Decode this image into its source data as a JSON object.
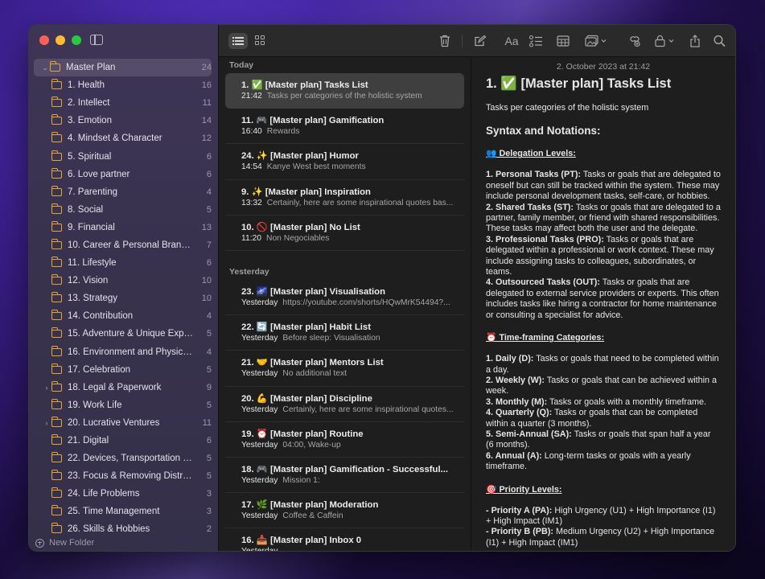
{
  "sidebar": {
    "new_folder_label": "New Folder",
    "folders": [
      {
        "name": "Master Plan",
        "count": "24",
        "chevron": "⌄",
        "selected": true,
        "indent": 0
      },
      {
        "name": "1. Health",
        "count": "16",
        "chevron": "",
        "indent": 1
      },
      {
        "name": "2. Intellect",
        "count": "11",
        "chevron": "",
        "indent": 1
      },
      {
        "name": "3. Emotion",
        "count": "14",
        "chevron": "",
        "indent": 1
      },
      {
        "name": "4. Mindset & Character",
        "count": "12",
        "chevron": "",
        "indent": 1
      },
      {
        "name": "5. Spiritual",
        "count": "6",
        "chevron": "",
        "indent": 1
      },
      {
        "name": "6. Love partner",
        "count": "6",
        "chevron": "",
        "indent": 1
      },
      {
        "name": "7. Parenting",
        "count": "4",
        "chevron": "",
        "indent": 1
      },
      {
        "name": "8. Social",
        "count": "5",
        "chevron": "",
        "indent": 1
      },
      {
        "name": "9. Financial",
        "count": "13",
        "chevron": "",
        "indent": 1
      },
      {
        "name": "10. Career & Personal Branding",
        "count": "7",
        "chevron": "",
        "indent": 1
      },
      {
        "name": "11. Lifestyle",
        "count": "6",
        "chevron": "",
        "indent": 1
      },
      {
        "name": "12. Vision",
        "count": "10",
        "chevron": "",
        "indent": 1
      },
      {
        "name": "13. Strategy",
        "count": "10",
        "chevron": "",
        "indent": 1
      },
      {
        "name": "14. Contribution",
        "count": "4",
        "chevron": "",
        "indent": 1
      },
      {
        "name": "15. Adventure & Unique Exper...",
        "count": "5",
        "chevron": "",
        "indent": 1
      },
      {
        "name": "16. Environment and Physical...",
        "count": "4",
        "chevron": "",
        "indent": 1
      },
      {
        "name": "17. Celebration",
        "count": "5",
        "chevron": "",
        "indent": 1
      },
      {
        "name": "18. Legal & Paperwork",
        "count": "9",
        "chevron": "›",
        "indent": 1
      },
      {
        "name": "19. Work Life",
        "count": "5",
        "chevron": "",
        "indent": 1
      },
      {
        "name": "20. Lucrative Ventures",
        "count": "11",
        "chevron": "›",
        "indent": 1
      },
      {
        "name": "21. Digital",
        "count": "6",
        "chevron": "",
        "indent": 1
      },
      {
        "name": "22. Devices, Transportation &...",
        "count": "5",
        "chevron": "",
        "indent": 1
      },
      {
        "name": "23. Focus & Removing Distrac...",
        "count": "5",
        "chevron": "",
        "indent": 1
      },
      {
        "name": "24. Life Problems",
        "count": "3",
        "chevron": "",
        "indent": 1
      },
      {
        "name": "25. Time Management",
        "count": "3",
        "chevron": "",
        "indent": 1
      },
      {
        "name": "26. Skills & Hobbies",
        "count": "2",
        "chevron": "",
        "indent": 1
      }
    ]
  },
  "notes": {
    "sections": [
      {
        "header": "Today",
        "items": [
          {
            "title": "1. ✅ [Master plan] Tasks List",
            "time": "21:42",
            "preview": "Tasks per categories of the holistic system",
            "selected": true
          },
          {
            "title": "11. 🎮 [Master plan] Gamification",
            "time": "16:40",
            "preview": "Rewards"
          },
          {
            "title": "24. ✨ [Master plan] Humor",
            "time": "14:54",
            "preview": "Kanye West best moments"
          },
          {
            "title": "9. ✨ [Master plan] Inspiration",
            "time": "13:32",
            "preview": "Certainly, here are some inspirational quotes bas..."
          },
          {
            "title": "10. 🚫 [Master plan] No List",
            "time": "11:20",
            "preview": "Non Negociables"
          }
        ]
      },
      {
        "header": "Yesterday",
        "items": [
          {
            "title": "23. 🌌 [Master plan] Visualisation",
            "time": "Yesterday",
            "preview": "https://youtube.com/shorts/HQwMrK5449​4?..."
          },
          {
            "title": "22. 🔄 [Master plan] Habit List",
            "time": "Yesterday",
            "preview": "Before sleep: Visualisation"
          },
          {
            "title": "21. 🤝 [Master plan] Mentors List",
            "time": "Yesterday",
            "preview": "No additional text"
          },
          {
            "title": "20. 💪 [Master plan] Discipline",
            "time": "Yesterday",
            "preview": "Certainly, here are some inspirational quotes..."
          },
          {
            "title": "19. ⏰ [Master plan] Routine",
            "time": "Yesterday",
            "preview": "04:00, Wake-up"
          },
          {
            "title": "18. 🎮 [Master plan] Gamification - Successful...",
            "time": "Yesterday",
            "preview": "Mission 1:"
          },
          {
            "title": "17. 🌿 [Master plan] Moderation",
            "time": "Yesterday",
            "preview": "Coffee & Caffein"
          },
          {
            "title": "16. 📥 [Master plan] Inbox 0",
            "time": "Yesterday",
            "preview": ""
          }
        ]
      }
    ]
  },
  "editor": {
    "date": "2. October 2023 at 21:42",
    "title": "1. ✅ [Master plan] Tasks List",
    "subtitle": "Tasks per categories of the holistic system",
    "syntax_heading": "Syntax and Notations:",
    "delegation_heading": "👥 Delegation Levels:",
    "delegation": [
      {
        "label": "1. Personal Tasks (PT):",
        "text": " Tasks or goals that are delegated to oneself but can still be tracked within the system. These may include personal development tasks, self-care, or hobbies."
      },
      {
        "label": "2. Shared Tasks (ST):",
        "text": " Tasks or goals that are delegated to a partner, family member, or friend with shared responsibilities. These tasks may affect both the user and the delegate."
      },
      {
        "label": "3. Professional Tasks (PRO):",
        "text": " Tasks or goals that are delegated within a professional or work context. These may include assigning tasks to colleagues, subordinates, or teams."
      },
      {
        "label": "4. Outsourced Tasks (OUT):",
        "text": " Tasks or goals that are delegated to external service providers or experts. This often includes tasks like hiring a contractor for home maintenance or consulting a specialist for advice."
      }
    ],
    "timeframe_heading": "⏰ Time-framing Categories:",
    "timeframe": [
      {
        "label": "1. Daily (D):",
        "text": " Tasks or goals that need to be completed within a day."
      },
      {
        "label": "2. Weekly (W):",
        "text": " Tasks or goals that can be achieved within a week."
      },
      {
        "label": "3. Monthly (M):",
        "text": " Tasks or goals with a monthly timeframe."
      },
      {
        "label": "4. Quarterly (Q):",
        "text": " Tasks or goals that can be completed within a quarter (3 months)."
      },
      {
        "label": "5. Semi-Annual (SA):",
        "text": " Tasks or goals that span half a year (6 months)."
      },
      {
        "label": "6. Annual (A):",
        "text": " Long-term tasks or goals with a yearly timeframe."
      }
    ],
    "priority_heading": "🎯 Priority Levels:",
    "priority": [
      {
        "label": "- Priority A (PA):",
        "text": " High Urgency (U1) + High Importance (I1) + High Impact (IM1)"
      },
      {
        "label": "- Priority B (PB):",
        "text": " Medium Urgency (U2) + High Importance (I1) + High Impact (IM1)"
      }
    ]
  },
  "colors": {
    "folder_icon": "#e6a537",
    "traffic_red": "#fe5f57",
    "traffic_yellow": "#febc2e",
    "traffic_green": "#28c840"
  }
}
